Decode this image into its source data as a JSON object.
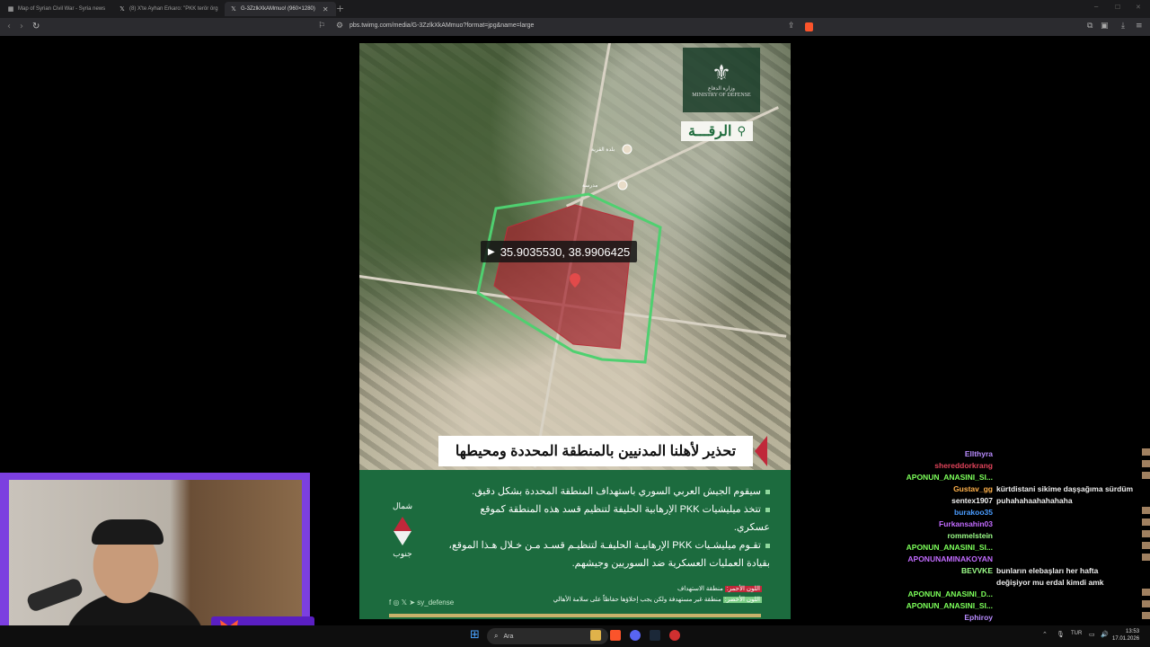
{
  "browser": {
    "tabs": [
      {
        "label": "Map of Syrian Civil War - Syria news",
        "icon": "map-icon",
        "active": false
      },
      {
        "label": "(8) X'te Ayhan Erkaro: \"PKK terör örg",
        "icon": "x-icon",
        "active": false
      },
      {
        "label": "G-3ZzlkXkAMmuo! (960×1280)",
        "icon": "x-icon",
        "active": true
      }
    ],
    "tab_close": "✕",
    "new_tab": "+",
    "url": "pbs.twimg.com/media/G-3ZzlkXkAMmuo?format=jpg&name=large"
  },
  "poster": {
    "ministry_ar": "وزارة الدفاع",
    "ministry_en": "MINISTRY OF DEFENSE",
    "place": "الرقـــة",
    "coordinates": "35.9035530, 38.9906425",
    "headline": "تحذير لأهلنا المدنيين بالمنطقة المحددة ومحيطها",
    "bullets": [
      "سيقوم الجيش العربي السوري باستهداف المنطقة المحددة بشكل دقيق.",
      "تتخذ ميليشيات PKK الإرهابية الحليفة لتنظيم قسد هذه المنطقة كموقع عسكري.",
      "تقـوم ميليشـيات PKK الإرهابيـة الحليفـة لتنظيـم قسـد مـن خـلال هـذا الموقع، بقيادة العمليات العسكرية ضد السوريين وجيشهم."
    ],
    "compass_north": "شمال",
    "compass_south": "جنوب",
    "legend_red_label": "اللون الأحمر:",
    "legend_red_text": "منطقة الاستهداف",
    "legend_green_label": "اللون الأخضر:",
    "legend_green_text": "منطقة غير مستهدفة ولكن يجب إخلاؤها حفاظاً على سلامة الأهالي",
    "social_handle": "sy_defense",
    "map_labels": [
      "بلدة القرية",
      "مدرسة"
    ]
  },
  "stream": {
    "brand": "purplebird"
  },
  "chat": [
    {
      "user": "Ellthyra",
      "color": "#b98cff",
      "msg": "",
      "emote": true
    },
    {
      "user": "shereddorkrang",
      "color": "#e0435a",
      "msg": "",
      "emote": true
    },
    {
      "user": "APONUN_ANASINI_SI...",
      "color": "#7cff5a",
      "msg": "",
      "emote": true
    },
    {
      "user": "Gustav_gg",
      "color": "#ffb14a",
      "msg": "kürtdistani sikime daşşağıma sürdüm",
      "emote": false
    },
    {
      "user": "sentex1907",
      "color": "#f0f0f0",
      "msg": "puhahahaahahahaha",
      "emote": false
    },
    {
      "user": "burakoo35",
      "color": "#4a9cff",
      "msg": "",
      "emote": true
    },
    {
      "user": "Furkansahin03",
      "color": "#c26bff",
      "msg": "",
      "emote": true
    },
    {
      "user": "rommelstein",
      "color": "#9dff8a",
      "msg": "",
      "emote": true
    },
    {
      "user": "APONUN_ANASINI_SI...",
      "color": "#7cff5a",
      "msg": "",
      "emote": true
    },
    {
      "user": "APONUNAMINAKOYAN",
      "color": "#c26bff",
      "msg": "",
      "emote": true
    },
    {
      "user": "BEVVKE",
      "color": "#9dff8a",
      "msg": "bunların elebaşları her hafta",
      "emote": false
    },
    {
      "user": "",
      "color": "#ffffff",
      "msg": "değişiyor mu erdal kimdi amk",
      "emote": false
    },
    {
      "user": "APONUN_ANASINI_D...",
      "color": "#7cff5a",
      "msg": "",
      "emote": true
    },
    {
      "user": "APONUN_ANASINI_SI...",
      "color": "#7cff5a",
      "msg": "",
      "emote": true
    },
    {
      "user": "Ephiroy",
      "color": "#b98cff",
      "msg": "",
      "emote": true
    }
  ],
  "taskbar": {
    "search_placeholder": "Ara",
    "language": "TUR",
    "time": "13:53",
    "date": "17.01.2026"
  },
  "colors": {
    "poster_green": "#1c6b3e",
    "target_red": "#c0283a",
    "stream_purple": "#7c3fe0"
  }
}
